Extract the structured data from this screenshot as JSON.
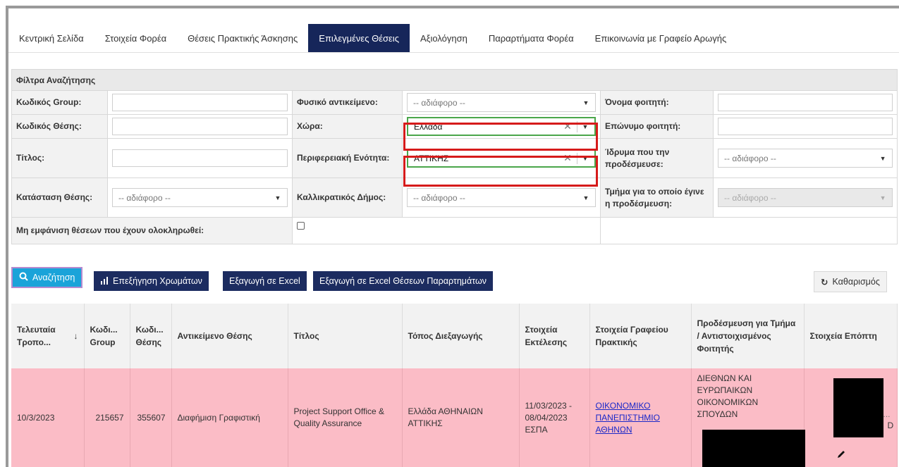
{
  "nav": {
    "tabs": [
      {
        "label": "Κεντρική Σελίδα",
        "active": false
      },
      {
        "label": "Στοιχεία Φορέα",
        "active": false
      },
      {
        "label": "Θέσεις Πρακτικής Άσκησης",
        "active": false
      },
      {
        "label": "Επιλεγμένες Θέσεις",
        "active": true
      },
      {
        "label": "Αξιολόγηση",
        "active": false
      },
      {
        "label": "Παραρτήματα Φορέα",
        "active": false
      },
      {
        "label": "Επικοινωνία με Γραφείο Αρωγής",
        "active": false
      }
    ]
  },
  "filters": {
    "title": "Φίλτρα Αναζήτησης",
    "group_code_label": "Κωδικός Group:",
    "position_code_label": "Κωδικός Θέσης:",
    "title_label": "Τίτλος:",
    "position_status_label": "Κατάσταση Θέσης:",
    "position_status_value": "-- αδιάφορο --",
    "physical_object_label": "Φυσικό αντικείμενο:",
    "physical_object_value": "-- αδιάφορο --",
    "country_label": "Χώρα:",
    "country_value": "Ελλάδα",
    "regional_unit_label": "Περιφερειακή Ενότητα:",
    "regional_unit_value": "ΑΤΤΙΚΗΣ",
    "municipality_label": "Καλλικρατικός Δήμος:",
    "municipality_value": "-- αδιάφορο --",
    "student_name_label": "Όνομα φοιτητή:",
    "student_surname_label": "Επώνυμο φοιτητή:",
    "institution_label": "Ίδρυμα που την προδέσμευσε:",
    "institution_value": "-- αδιάφορο --",
    "department_label": "Τμήμα για το οποίο έγινε η προδέσμευση:",
    "department_value": "-- αδιάφορο --",
    "hide_completed_label": "Μη εμφάνιση θέσεων που έχουν ολοκληρωθεί:"
  },
  "buttons": {
    "search": "Αναζήτηση",
    "colors": "Επεξήγηση Χρωμάτων",
    "export_excel": "Εξαγωγή σε Excel",
    "export_annex": "Εξαγωγή σε Excel Θέσεων Παραρτημάτων",
    "clear": "Καθαρισμός"
  },
  "table": {
    "headers": [
      "Τελευταία Τροπο...",
      "Κωδι... Group",
      "Κωδι... Θέσης",
      "Αντικείμενο Θέσης",
      "Τίτλος",
      "Τόπος Διεξαγωγής",
      "Στοιχεία Εκτέλεσης",
      "Στοιχεία Γραφείου Πρακτικής",
      "Προδέσμευση για Τμήμα / Αντιστοιχισμένος Φοιτητής",
      "Στοιχεία Επόπτη"
    ],
    "rows": [
      {
        "last_modified": "10/3/2023",
        "group_code": "215657",
        "position_code": "355607",
        "subject": "Διαφήμιση Γραφιστική",
        "title": "Project Support Office & Quality Assurance",
        "location": "Ελλάδα ΑΘΗΝΑΙΩΝ ΑΤΤΙΚΗΣ",
        "execution": "11/03/2023 - 08/04/2023 ΕΣΠΑ",
        "office": "ΟΙΚΟΝΟΜΙΚΟ ΠΑΝΕΠΙΣΤΗΜΙΟ ΑΘΗΝΩΝ",
        "reservation": "ΔΙΕΘΝΩΝ ΚΑΙ ΕΥΡΩΠΑΙΚΩΝ ΟΙΚΟΝΟΜΙΚΩΝ ΣΠΟΥΔΩΝ",
        "supervisor_fragment": "...",
        "supervisor_fragment_2": "D"
      }
    ]
  },
  "colors": {
    "nav_active": "#16265a",
    "search_button": "#1aa3d9",
    "dark_button": "#1c2c60",
    "row_highlight": "#fbbcc6",
    "annotation_red": "#d61b1b"
  }
}
